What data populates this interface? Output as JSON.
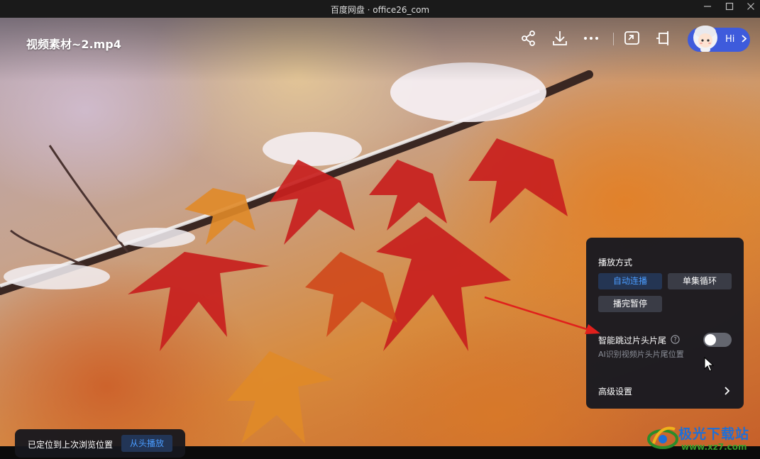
{
  "window": {
    "title": "百度网盘 · office26_com",
    "controls": [
      "minimize-icon",
      "maximize-icon",
      "close-icon"
    ]
  },
  "player": {
    "video_title": "视频素材~2.mp4",
    "toolbar_icons": [
      "share-icon",
      "download-icon",
      "more-icon",
      "picture-in-picture-icon",
      "mini-window-icon"
    ],
    "assistant": {
      "label": "Hi",
      "icon": "chevron-right-icon"
    }
  },
  "settings_panel": {
    "playback_mode_heading": "播放方式",
    "playback_modes": [
      {
        "label": "自动连播",
        "active": true
      },
      {
        "label": "单集循环",
        "active": false
      },
      {
        "label": "播完暂停",
        "active": false
      }
    ],
    "skip_intro": {
      "label": "智能跳过片头片尾",
      "description": "AI识别视频片头片尾位置",
      "enabled": false
    },
    "advanced_label": "高级设置"
  },
  "toast": {
    "message": "已定位到上次浏览位置",
    "action_label": "从头播放"
  },
  "watermark": {
    "title": "极光下载站",
    "url": "www.xz7.com"
  },
  "colors": {
    "accent": "#4a9cff",
    "panel_bg": "#181920",
    "annotation_arrow": "#e0201c",
    "assistant_pill": "#3e5bdc"
  }
}
